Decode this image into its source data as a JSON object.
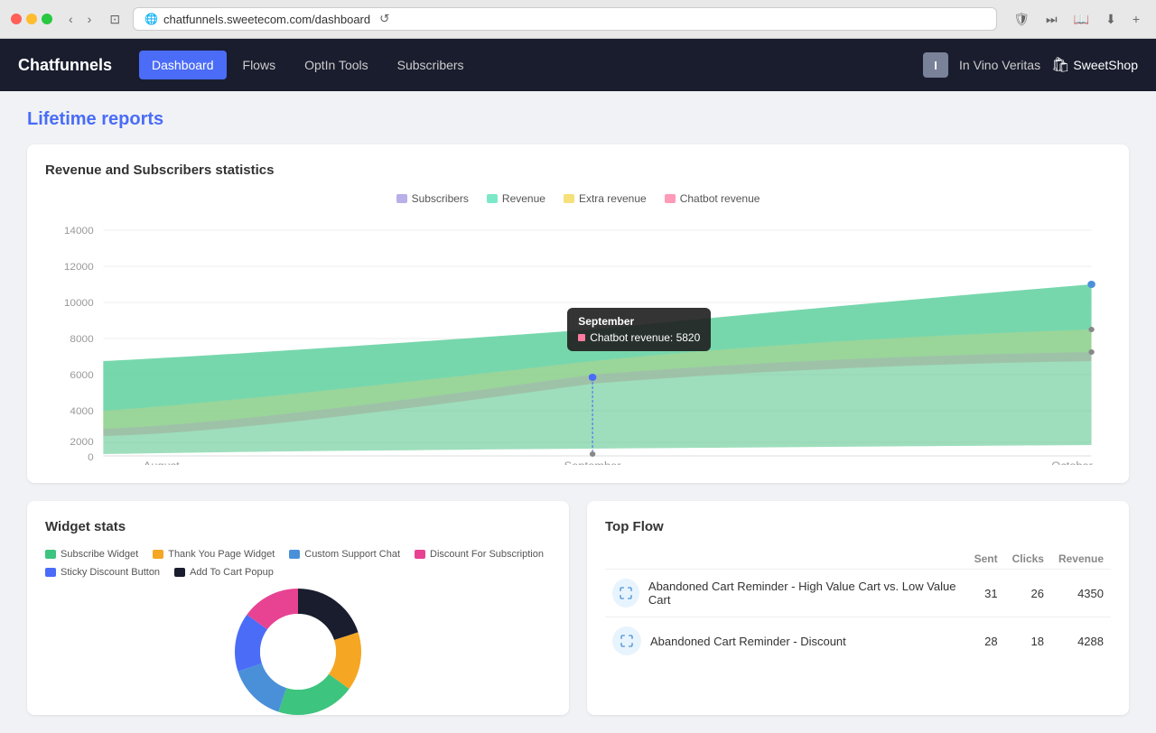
{
  "browser": {
    "url": "chatfunnels.sweetecom.com/dashboard",
    "reload_label": "↺"
  },
  "nav": {
    "logo": "Chatfunnels",
    "items": [
      {
        "label": "Dashboard",
        "active": true
      },
      {
        "label": "Flows",
        "active": false
      },
      {
        "label": "OptIn Tools",
        "active": false
      },
      {
        "label": "Subscribers",
        "active": false
      }
    ],
    "user_initial": "I",
    "store_name": "In Vino Veritas",
    "shop_label": "SweetShop"
  },
  "page": {
    "title": "Lifetime reports"
  },
  "chart": {
    "title": "Revenue and Subscribers statistics",
    "legend": [
      {
        "label": "Subscribers",
        "color": "#b8b0e8"
      },
      {
        "label": "Revenue",
        "color": "#7de8c8"
      },
      {
        "label": "Extra revenue",
        "color": "#f5e07a"
      },
      {
        "label": "Chatbot revenue",
        "color": "#ff9ab8"
      }
    ],
    "x_labels": [
      "August",
      "September",
      "October"
    ],
    "y_labels": [
      "0",
      "2000",
      "4000",
      "6000",
      "8000",
      "10000",
      "12000",
      "14000"
    ],
    "tooltip": {
      "title": "September",
      "row_label": "Chatbot revenue: 5820"
    }
  },
  "widget_stats": {
    "title": "Widget stats",
    "legend": [
      {
        "label": "Subscribe Widget",
        "color": "#3dc47e"
      },
      {
        "label": "Thank You Page Widget",
        "color": "#f5a623"
      },
      {
        "label": "Custom Support Chat",
        "color": "#4a90d9"
      },
      {
        "label": "Discount For Subscription",
        "color": "#e84393"
      },
      {
        "label": "Sticky Discount Button",
        "color": "#4a6cf7"
      },
      {
        "label": "Add To Cart Popup",
        "color": "#1a1d2e"
      }
    ]
  },
  "top_flow": {
    "title": "Top Flow",
    "headers": [
      "",
      "Sent",
      "Clicks",
      "Revenue"
    ],
    "rows": [
      {
        "name": "Abandoned Cart Reminder - High Value Cart vs. Low Value Cart",
        "sent": 31,
        "clicks": 26,
        "revenue": 4350
      },
      {
        "name": "Abandoned Cart Reminder - Discount",
        "sent": 28,
        "clicks": 18,
        "revenue": 4288
      }
    ]
  }
}
